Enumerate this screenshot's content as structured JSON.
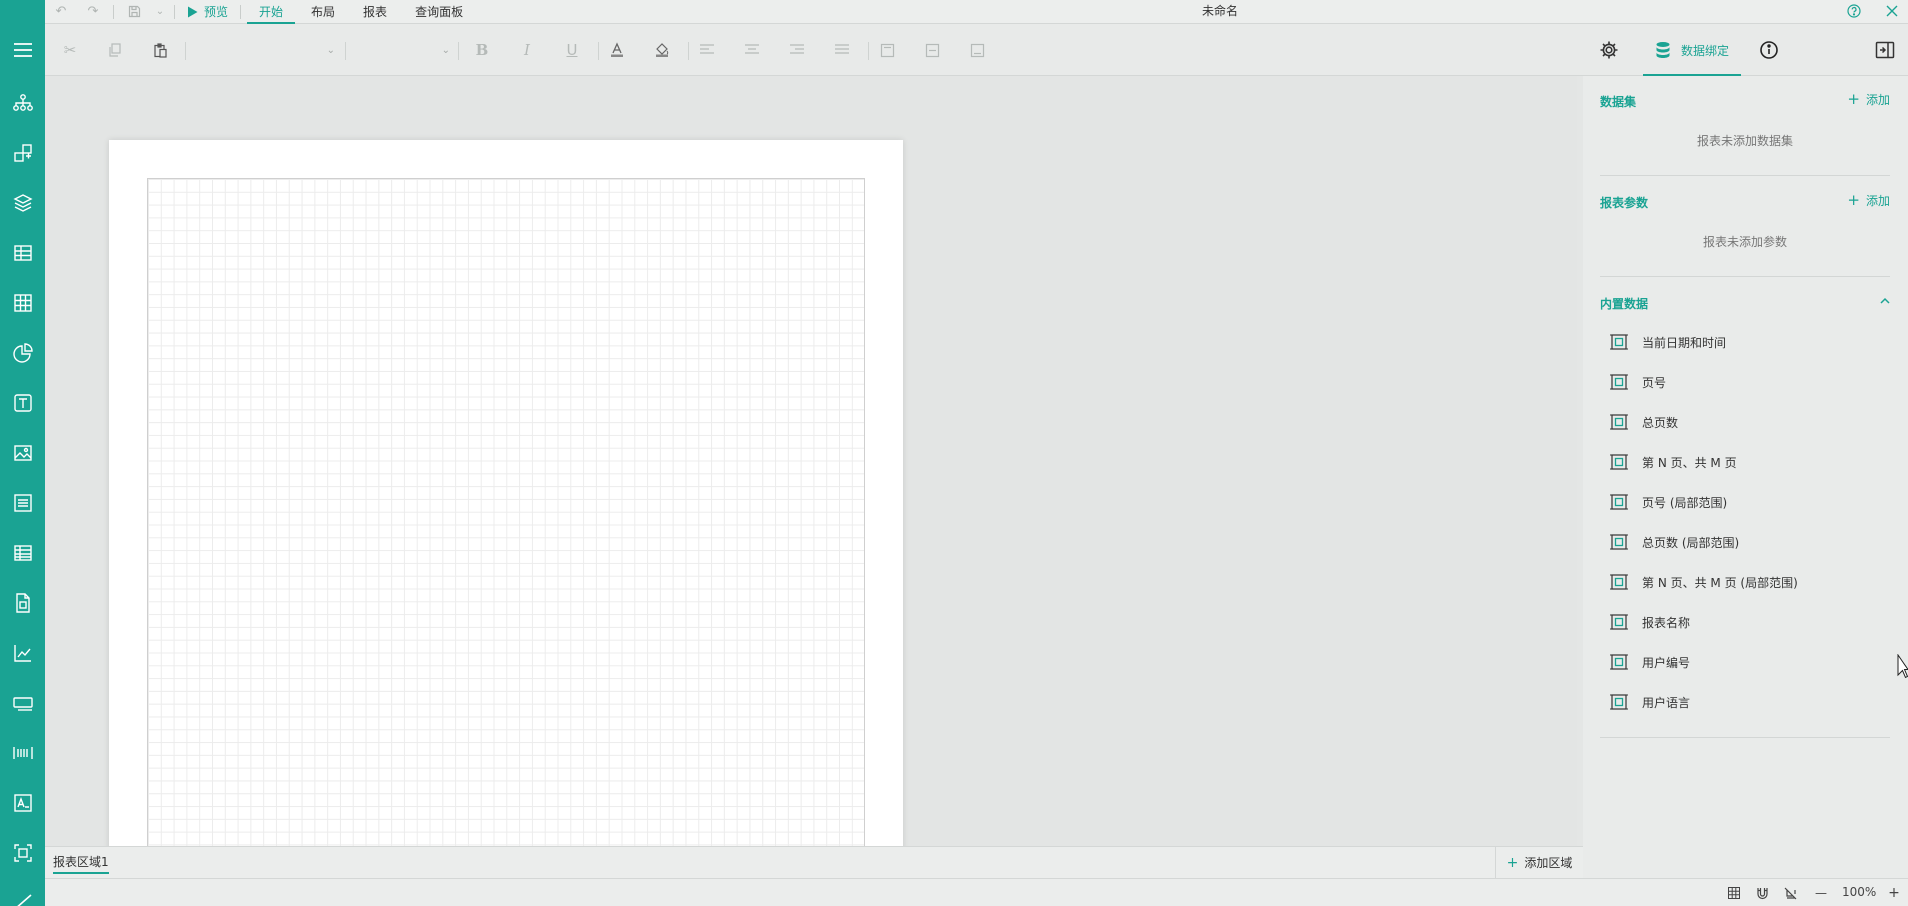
{
  "window": {
    "title": "未命名"
  },
  "menu": {
    "preview_label": "预览",
    "tabs": [
      {
        "label": "开始",
        "active": true
      },
      {
        "label": "布局",
        "active": false
      },
      {
        "label": "报表",
        "active": false
      },
      {
        "label": "查询面板",
        "active": false
      }
    ]
  },
  "sidebar": {
    "items": [
      "menu-icon",
      "tree-icon",
      "components-icon",
      "layers-icon",
      "table-icon",
      "grid-icon",
      "pie-chart-icon",
      "text-icon",
      "image-icon",
      "list-icon",
      "tablix-icon",
      "subreport-icon",
      "line-chart-icon",
      "input-icon",
      "barcode-icon",
      "textbox-icon",
      "container-icon",
      "line-icon"
    ]
  },
  "right_panel": {
    "binding_tab_label": "数据绑定",
    "datasets": {
      "title": "数据集",
      "add_label": "添加",
      "empty_text": "报表未添加数据集"
    },
    "parameters": {
      "title": "报表参数",
      "add_label": "添加",
      "empty_text": "报表未添加参数"
    },
    "builtin": {
      "title": "内置数据",
      "items": [
        "当前日期和时间",
        "页号",
        "总页数",
        "第 N 页、共 M 页",
        "页号 (局部范围)",
        "总页数 (局部范围)",
        "第 N 页、共 M 页 (局部范围)",
        "报表名称",
        "用户编号",
        "用户语言"
      ]
    }
  },
  "bottom": {
    "area_tab": "报表区域1",
    "add_area_label": "添加区域"
  },
  "status": {
    "zoom": "100%"
  },
  "colors": {
    "accent": "#1aa393",
    "background": "#e4e6e5"
  }
}
